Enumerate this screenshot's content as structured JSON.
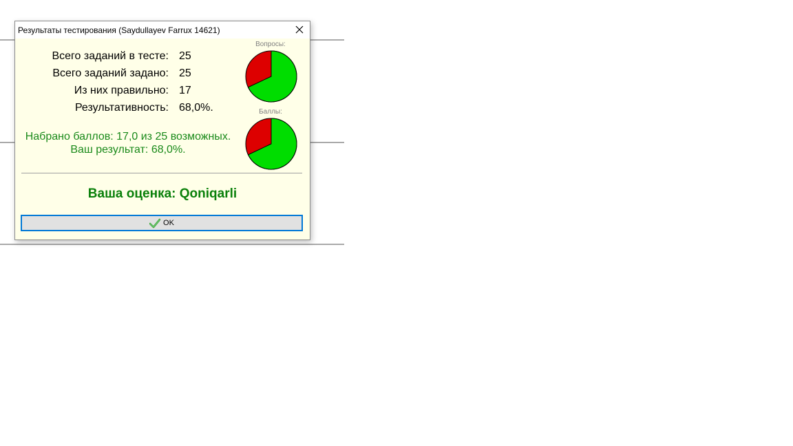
{
  "window": {
    "title": "Результаты тестирования (Saydullayev Farrux 14621)"
  },
  "stats": [
    {
      "label": "Всего заданий в тесте:",
      "value": "25"
    },
    {
      "label": "Всего заданий задано:",
      "value": "25"
    },
    {
      "label": "Из них правильно:",
      "value": "17"
    },
    {
      "label": "Результативность:",
      "value": "68,0%."
    }
  ],
  "summary": {
    "points": "Набрано баллов: 17,0 из 25 возможных.",
    "result": "Ваш результат: 68,0%."
  },
  "pies": [
    {
      "caption": "Вопросы:",
      "correct_fraction": 0.68
    },
    {
      "caption": "Баллы:",
      "correct_fraction": 0.68
    }
  ],
  "grade": "Ваша оценка: Qoniqarli",
  "ok_button": {
    "label": "OK",
    "icon": "checkmark-icon"
  },
  "colors": {
    "dialog_bg": "#ffffe8",
    "correct": "#00dd00",
    "wrong": "#dd0000",
    "summary_text": "#1a8a1a",
    "grade_text": "#0a800a",
    "button_border": "#0078d7"
  }
}
